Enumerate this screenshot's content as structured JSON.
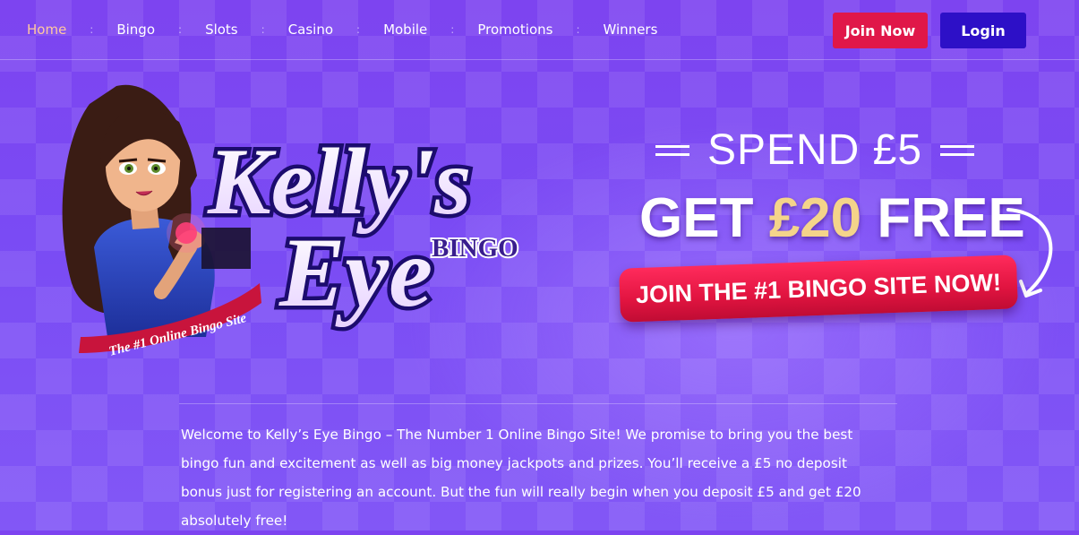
{
  "nav": {
    "items": [
      {
        "label": "Home",
        "active": true
      },
      {
        "label": "Bingo"
      },
      {
        "label": "Slots"
      },
      {
        "label": "Casino"
      },
      {
        "label": "Mobile"
      },
      {
        "label": "Promotions"
      },
      {
        "label": "Winners"
      }
    ],
    "separator": ":"
  },
  "header": {
    "join_label": "Join Now",
    "login_label": "Login"
  },
  "logo": {
    "line1": "Kelly's",
    "line2": "Eye",
    "badge": "BINGO",
    "ribbon": "The #1 Online Bingo Site"
  },
  "promo": {
    "line1": "SPEND £5",
    "get": "GET",
    "amount": "£20",
    "free": "FREE",
    "banner": "JOIN THE #1 BINGO SITE NOW!"
  },
  "intro": {
    "text": "Welcome to Kelly’s Eye Bingo – The Number 1 Online Bingo Site! We promise to bring you the best bingo fun and excitement as well as big money jackpots and prizes. You’ll receive a £5 no deposit bonus just for registering an account. But the fun will really begin when you deposit £5 and get £20 absolutely free!"
  },
  "colors": {
    "background": "#7d44f0",
    "join_button": "#e01749",
    "login_button": "#2d10c7",
    "nav_active": "#ffc8a0",
    "promo_amount": "#f4d48a",
    "logo_script": "#f6e9ff",
    "logo_outline": "#d1146a"
  }
}
